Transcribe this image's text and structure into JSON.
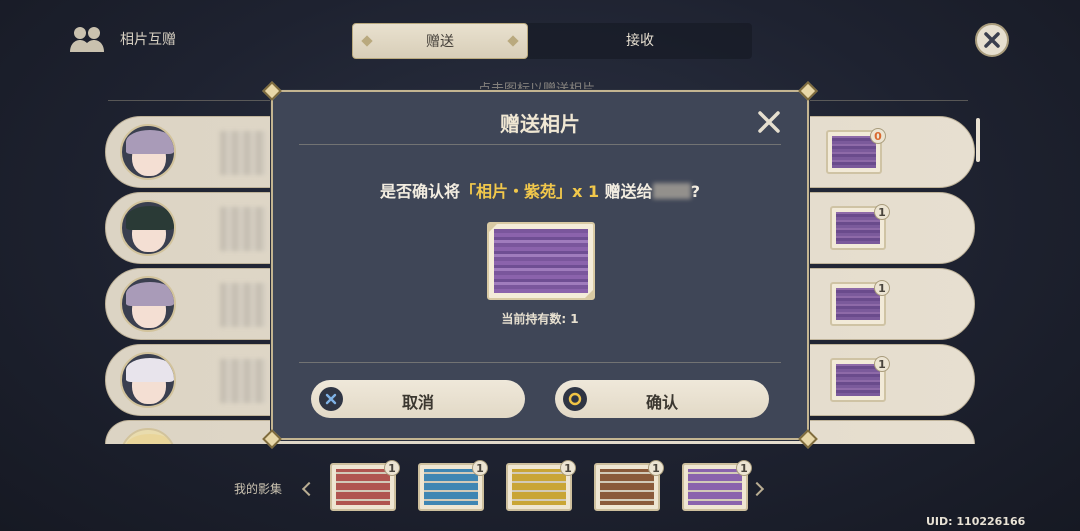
{
  "header": {
    "title": "相片互赠",
    "title_icon": "friends-icon",
    "tabs": [
      {
        "label": "赠送",
        "active": true
      },
      {
        "label": "接收",
        "active": false
      }
    ],
    "close_icon": "close-icon"
  },
  "hint_text": "点击图标以赠送相片",
  "friends": [
    {
      "avatar": "purple-hair-character",
      "card_count": "0"
    },
    {
      "avatar": "dark-hair-green-character",
      "card_count": "1"
    },
    {
      "avatar": "purple-hair-character",
      "card_count": "1"
    },
    {
      "avatar": "white-hair-character",
      "card_count": "1"
    },
    {
      "avatar": "blonde-character",
      "card_count": ""
    }
  ],
  "dialog": {
    "title": "赠送相片",
    "question_pre": "是否确认将",
    "question_item": "「相片・紫苑」",
    "question_qty": "x 1",
    "question_mid": "赠送给",
    "question_post": "?",
    "held_label": "当前持有数: 1",
    "cancel_label": "取消",
    "confirm_label": "确认",
    "cancel_icon": "x-button-icon",
    "confirm_icon": "o-button-icon"
  },
  "album": {
    "label": "我的影集",
    "cards": [
      {
        "color": "#b0554f",
        "count": "1"
      },
      {
        "color": "#3f86b3",
        "count": "1"
      },
      {
        "color": "#c9a536",
        "count": "1"
      },
      {
        "color": "#8a5a3a",
        "count": "1"
      },
      {
        "color": "#8a63ad",
        "count": "1"
      }
    ]
  },
  "uid": "UID: 110226166"
}
